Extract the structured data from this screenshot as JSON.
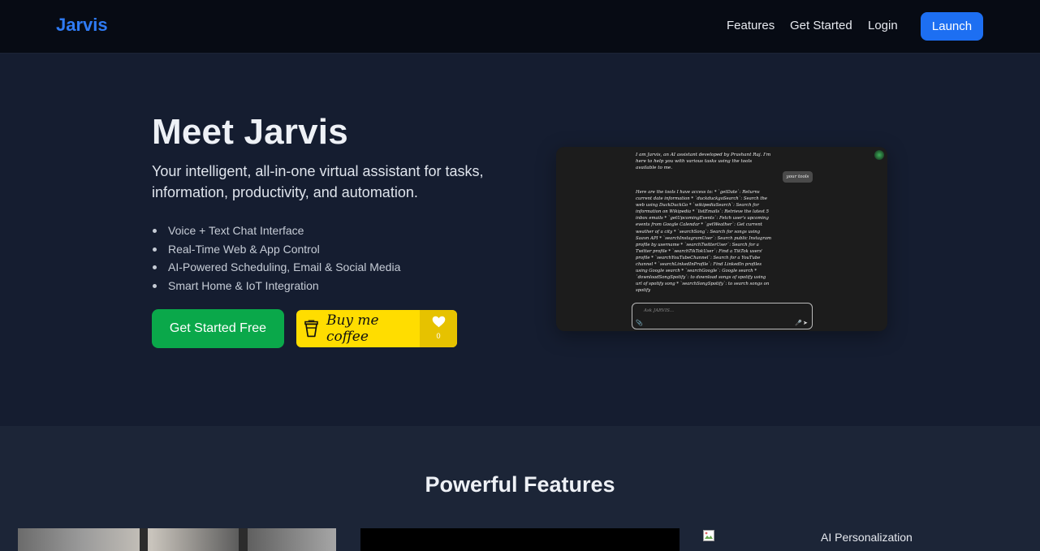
{
  "nav": {
    "brand": "Jarvis",
    "links": [
      "Features",
      "Get Started",
      "Login"
    ],
    "launch": "Launch"
  },
  "hero": {
    "title": "Meet Jarvis",
    "subtitle": "Your intelligent, all-in-one virtual assistant for tasks, information, productivity, and automation.",
    "bullets": [
      "Voice + Text Chat Interface",
      "Real-Time Web & App Control",
      "AI-Powered Scheduling, Email & Social Media",
      "Smart Home & IoT Integration"
    ],
    "cta": "Get Started Free",
    "coffee": {
      "label": "Buy me coffee",
      "count": "0"
    }
  },
  "preview": {
    "intro": "I am Jarvis, an AI assistant developed by Prashant Raj. I'm here to help you with various tasks using the tools available to me.",
    "user_message": "your tools",
    "tools_text": "Here are the tools I have access to: * `getDate`: Returns current date information * `duckduckgoSearch`: Search the web using DuckDuckGo * `wikipediaSearch`: Search for information on Wikipedia * `listEmails`: Retrieve the latest 5 inbox emails * `getUpcomingEvents`: Fetch user's upcoming events from Google Calendar * `getWeather`: Get current weather of a city * `searchSong`: Search for songs using Saavn API * `searchInstagramUser`: Search public Instagram profile by username * `searchTwitterUser`: Search for a Twitter profile * `searchTikTokUser`: Find a TikTok users' profile * `searchYouTubeChannel`: Search for a YouTube channel * `searchLinkedInProfile`: Find LinkedIn profiles using Google search * `searchGoogle`: Google search * `downloadSongSpotify`: to download songs of spotify using url of spotify song * `searchSongSpotify`: to search songs on spotify",
    "input_placeholder": "Ask JARVIS...",
    "clip_icon": "paperclip-icon",
    "mic_icon": "microphone-icon",
    "send_icon": "send-icon"
  },
  "features": {
    "title": "Powerful Features",
    "card3_alt": "AI Personalization"
  },
  "colors": {
    "brand": "#2f7bf4",
    "launch": "#1d6ff2",
    "cta_green": "#0aa84a",
    "coffee_yellow": "#ffdd00"
  }
}
